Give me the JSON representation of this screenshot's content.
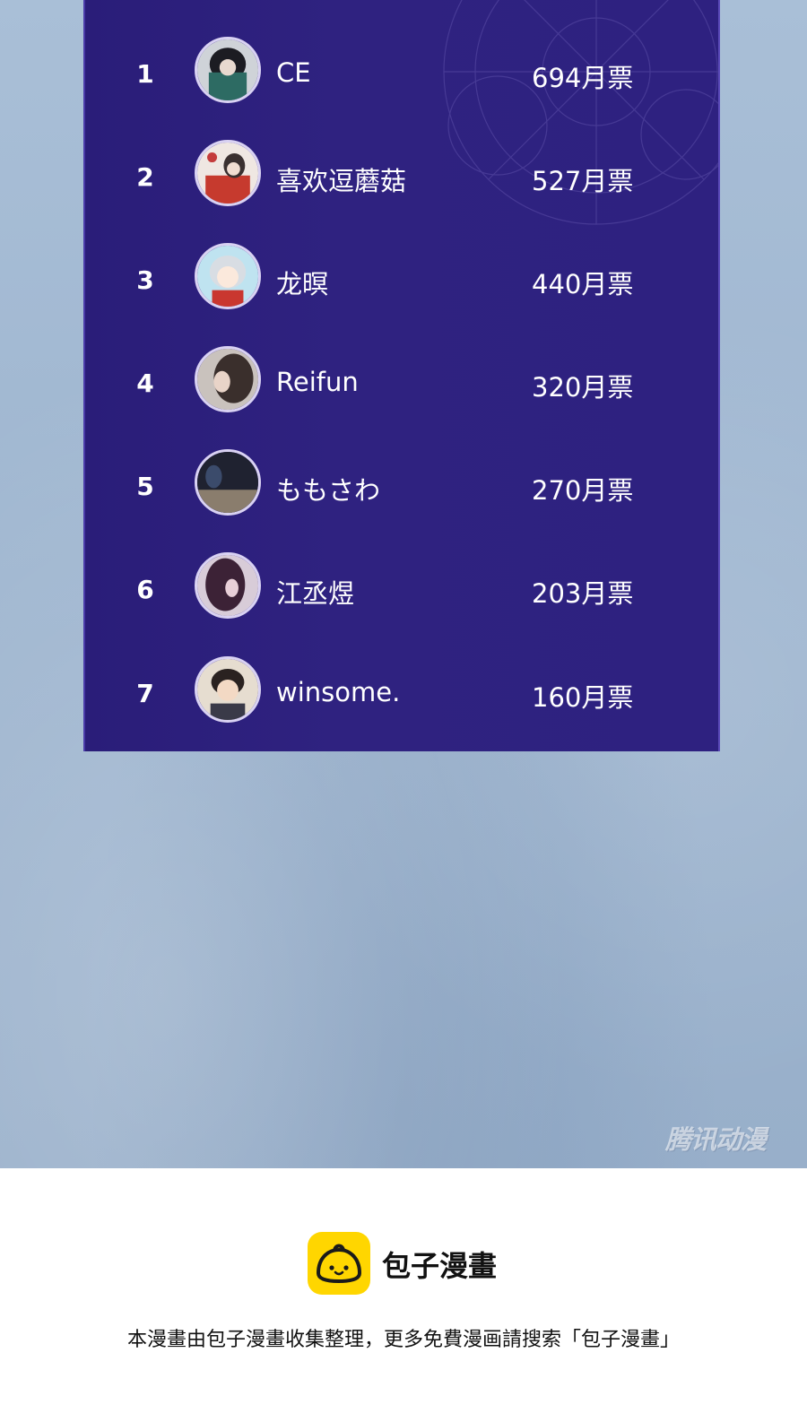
{
  "ranking": {
    "entries": [
      {
        "rank": "1",
        "name": "CE",
        "votes": "694月票",
        "avatar": "avatar-dark-hair-boy"
      },
      {
        "rank": "2",
        "name": "喜欢逗蘑菇",
        "votes": "527月票",
        "avatar": "avatar-red-robe-couple"
      },
      {
        "rank": "3",
        "name": "龙暝",
        "votes": "440月票",
        "avatar": "avatar-white-hair-chibi"
      },
      {
        "rank": "4",
        "name": "Reifun",
        "votes": "320月票",
        "avatar": "avatar-girl-profile"
      },
      {
        "rank": "5",
        "name": "ももさわ",
        "votes": "270月票",
        "avatar": "avatar-dark-room"
      },
      {
        "rank": "6",
        "name": "江丞煜",
        "votes": "203月票",
        "avatar": "avatar-purple-hair"
      },
      {
        "rank": "7",
        "name": "winsome.",
        "votes": "160月票",
        "avatar": "avatar-child-photo"
      }
    ]
  },
  "watermark": "腾讯动漫",
  "footer": {
    "brand": "包子漫畫",
    "logo_icon": "bun-logo-icon",
    "logo_color": "#ffd600",
    "notice": "本漫畫由包子漫畫收集整理，更多免費漫画請搜索「包子漫畫」"
  },
  "colors": {
    "panel": "#2f2280",
    "background": "#a3bad3"
  }
}
